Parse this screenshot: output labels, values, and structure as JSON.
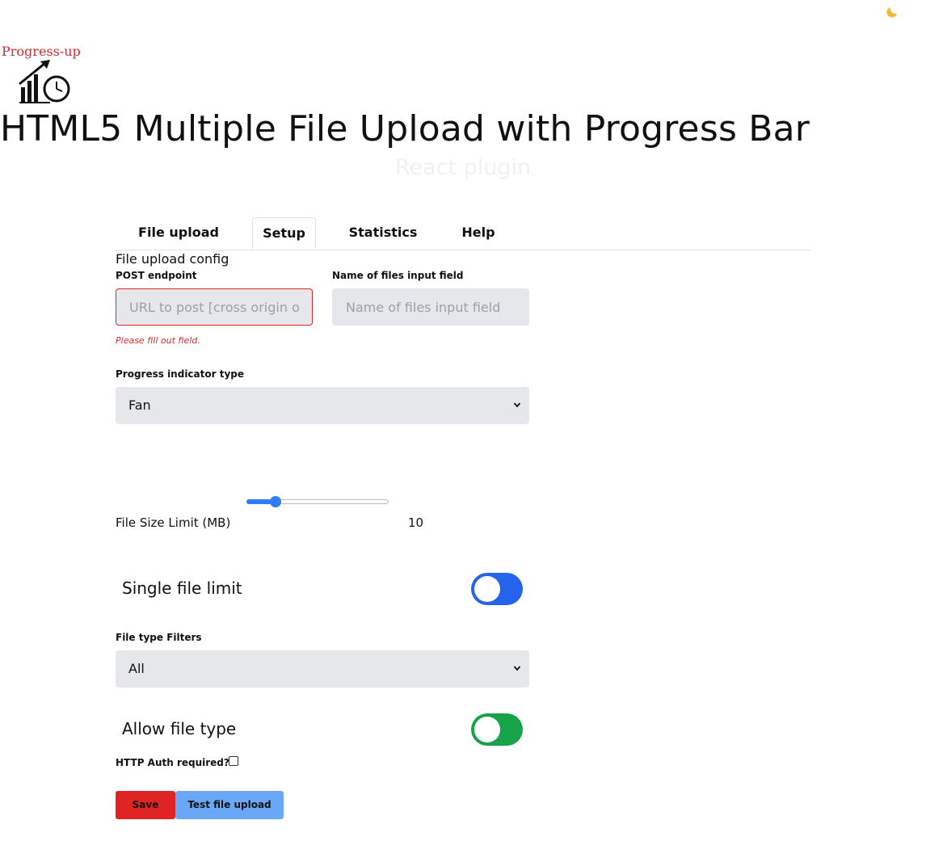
{
  "header": {
    "theme_icon": "moon-icon",
    "logo_text": "Progress-up",
    "logo_icon": "chart-clock-logo-icon",
    "title": "HTML5 Multiple File Upload with Progress Bar",
    "subtitle": "React plugin"
  },
  "tabs": [
    {
      "label": "File upload",
      "active": false
    },
    {
      "label": "Setup",
      "active": true
    },
    {
      "label": "Statistics",
      "active": false
    },
    {
      "label": "Help",
      "active": false
    }
  ],
  "setup": {
    "section_title": "File upload config",
    "post_endpoint": {
      "label": "POST endpoint",
      "placeholder": "URL to post [cross origin or all]",
      "value": "",
      "error": "Please fill out field."
    },
    "files_field_name": {
      "label": "Name of files input field",
      "placeholder": "Name of files input field",
      "value": ""
    },
    "progress_type": {
      "label": "Progress indicator type",
      "selected": "Fan",
      "chevron_icon": "chevron-down-icon"
    },
    "file_size_limit": {
      "label": "File Size Limit (MB)",
      "value": "10",
      "fraction": 0.18
    },
    "single_file_limit": {
      "label": "Single file limit",
      "on": false,
      "color": "#2563eb"
    },
    "file_type_filters": {
      "label": "File type Filters",
      "selected": "All",
      "chevron_icon": "chevron-down-icon"
    },
    "allow_file_type": {
      "label": "Allow file type",
      "on": false,
      "color": "#16a34a"
    },
    "http_auth": {
      "label": "HTTP Auth required?",
      "checked": false
    },
    "buttons": {
      "save": "Save",
      "test": "Test file upload"
    }
  },
  "colors": {
    "error": "#e02424",
    "accent": "#2f7df6",
    "save_button": "#e02424",
    "test_button": "#6aa8f7"
  }
}
